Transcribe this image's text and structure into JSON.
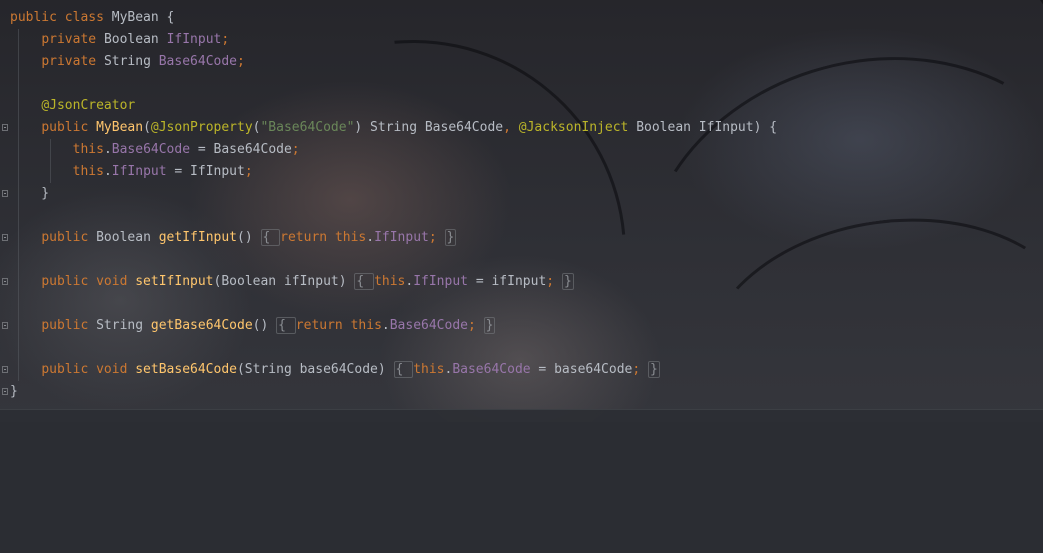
{
  "code": {
    "lines": [
      [
        [
          "kw",
          "public class "
        ],
        [
          "txt",
          "MyBean {"
        ]
      ],
      [
        [
          "txt",
          "    "
        ],
        [
          "kw",
          "private "
        ],
        [
          "txt",
          "Boolean "
        ],
        [
          "fld",
          "IfInput"
        ],
        [
          "kw",
          ";"
        ]
      ],
      [
        [
          "txt",
          "    "
        ],
        [
          "kw",
          "private "
        ],
        [
          "txt",
          "String "
        ],
        [
          "fld",
          "Base64Code"
        ],
        [
          "kw",
          ";"
        ]
      ],
      [],
      [
        [
          "txt",
          "    "
        ],
        [
          "ann",
          "@JsonCreator"
        ]
      ],
      [
        [
          "txt",
          "    "
        ],
        [
          "kw",
          "public "
        ],
        [
          "mth",
          "MyBean"
        ],
        [
          "txt",
          "("
        ],
        [
          "ann",
          "@JsonProperty"
        ],
        [
          "txt",
          "("
        ],
        [
          "str",
          "\"Base64Code\""
        ],
        [
          "txt",
          ") String Base64Code"
        ],
        [
          "kw",
          ", "
        ],
        [
          "ann",
          "@JacksonInject "
        ],
        [
          "txt",
          "Boolean IfInput) {"
        ]
      ],
      [
        [
          "txt",
          "        "
        ],
        [
          "kw",
          "this"
        ],
        [
          "txt",
          "."
        ],
        [
          "fld",
          "Base64Code"
        ],
        [
          "txt",
          " = Base64Code"
        ],
        [
          "kw",
          ";"
        ]
      ],
      [
        [
          "txt",
          "        "
        ],
        [
          "kw",
          "this"
        ],
        [
          "txt",
          "."
        ],
        [
          "fld",
          "IfInput"
        ],
        [
          "txt",
          " = IfInput"
        ],
        [
          "kw",
          ";"
        ]
      ],
      [
        [
          "txt",
          "    }"
        ]
      ],
      [],
      [
        [
          "txt",
          "    "
        ],
        [
          "kw",
          "public "
        ],
        [
          "txt",
          "Boolean "
        ],
        [
          "mth",
          "getIfInput"
        ],
        [
          "txt",
          "() "
        ],
        [
          "box",
          "{ "
        ],
        [
          "kw",
          "return this"
        ],
        [
          "txt",
          "."
        ],
        [
          "fld",
          "IfInput"
        ],
        [
          "kw",
          "; "
        ],
        [
          "box",
          "}"
        ]
      ],
      [],
      [
        [
          "txt",
          "    "
        ],
        [
          "kw",
          "public void "
        ],
        [
          "mth",
          "setIfInput"
        ],
        [
          "txt",
          "(Boolean ifInput) "
        ],
        [
          "box",
          "{ "
        ],
        [
          "kw",
          "this"
        ],
        [
          "txt",
          "."
        ],
        [
          "fld",
          "IfInput"
        ],
        [
          "txt",
          " = ifInput"
        ],
        [
          "kw",
          "; "
        ],
        [
          "box",
          "}"
        ]
      ],
      [],
      [
        [
          "txt",
          "    "
        ],
        [
          "kw",
          "public "
        ],
        [
          "txt",
          "String "
        ],
        [
          "mth",
          "getBase64Code"
        ],
        [
          "txt",
          "() "
        ],
        [
          "box",
          "{ "
        ],
        [
          "kw",
          "return this"
        ],
        [
          "txt",
          "."
        ],
        [
          "fld",
          "Base64Code"
        ],
        [
          "kw",
          "; "
        ],
        [
          "box",
          "}"
        ]
      ],
      [],
      [
        [
          "txt",
          "    "
        ],
        [
          "kw",
          "public void "
        ],
        [
          "mth",
          "setBase64Code"
        ],
        [
          "txt",
          "(String base64Code) "
        ],
        [
          "box",
          "{ "
        ],
        [
          "kw",
          "this"
        ],
        [
          "txt",
          "."
        ],
        [
          "fld",
          "Base64Code"
        ],
        [
          "txt",
          " = base64Code"
        ],
        [
          "kw",
          "; "
        ],
        [
          "box",
          "}"
        ]
      ],
      [
        [
          "txt",
          "}"
        ]
      ]
    ],
    "fold_markers_at_lines": [
      5,
      8,
      10,
      12,
      14,
      16,
      17
    ]
  }
}
